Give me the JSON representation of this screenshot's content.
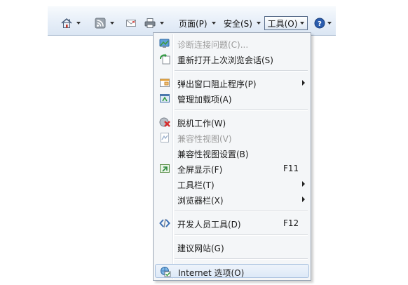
{
  "toolbar": {
    "page_label": "页面(P)",
    "safety_label": "安全(S)",
    "tools_label": "工具(O)",
    "icons": [
      "home-icon",
      "feeds-icon",
      "mail-icon",
      "print-icon",
      "help-icon"
    ],
    "accent_color": "#2a5cae"
  },
  "menu": {
    "items": [
      {
        "label": "诊断连接问题(C)...",
        "disabled": true,
        "icon": "diagnose-icon"
      },
      {
        "label": "重新打开上次浏览会话(S)",
        "icon": "reopen-session-icon"
      },
      {
        "label": "弹出窗口阻止程序(P)",
        "submenu": true,
        "icon": "popup-blocker-icon"
      },
      {
        "label": "管理加载项(A)",
        "icon": "addons-icon"
      },
      {
        "label": "脱机工作(W)",
        "icon": "offline-icon"
      },
      {
        "label": "兼容性视图(V)",
        "disabled": true,
        "icon": "compat-view-icon"
      },
      {
        "label": "兼容性视图设置(B)"
      },
      {
        "label": "全屏显示(F)",
        "shortcut": "F11",
        "icon": "fullscreen-icon"
      },
      {
        "label": "工具栏(T)",
        "submenu": true
      },
      {
        "label": "浏览器栏(X)",
        "submenu": true
      },
      {
        "label": "开发人员工具(D)",
        "shortcut": "F12",
        "icon": "dev-tools-icon"
      },
      {
        "label": "建议网站(G)"
      },
      {
        "label": "Internet 选项(O)",
        "icon": "internet-options-icon",
        "highlighted": true
      }
    ]
  }
}
